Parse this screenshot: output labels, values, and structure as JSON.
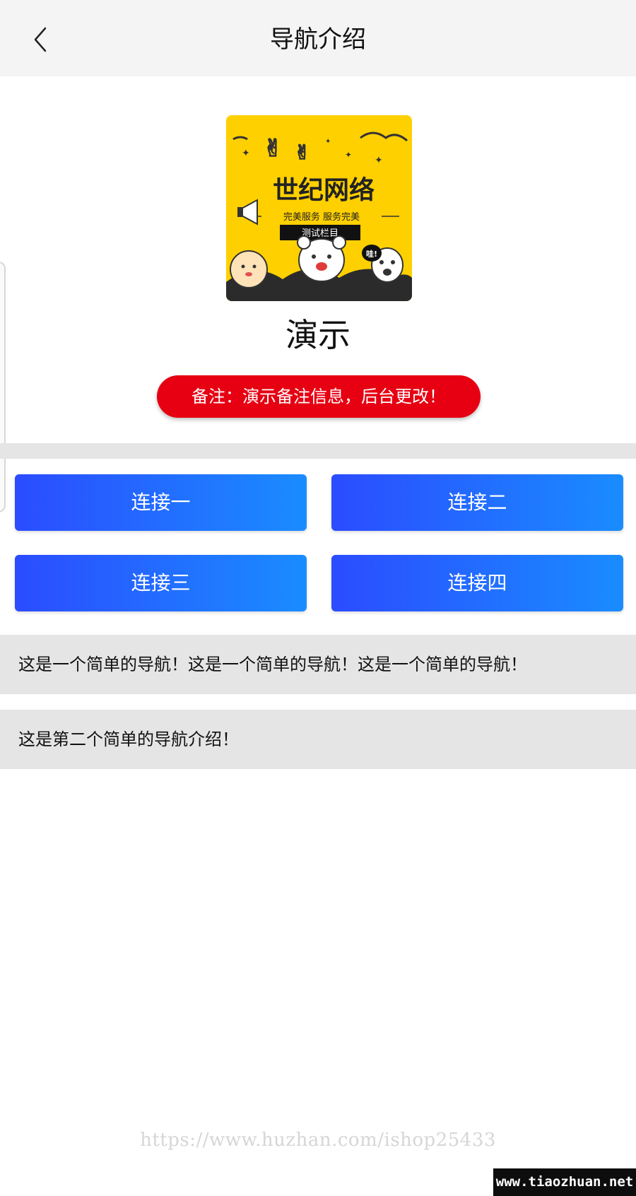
{
  "header": {
    "title": "导航介绍",
    "back_icon": "chevron-left-icon"
  },
  "logo": {
    "title": "世纪网络",
    "subtitle": "完美服务 服务完美",
    "tag": "测试栏目",
    "exclaim": "哇!",
    "background_color": "#ffd000"
  },
  "profile": {
    "name": "演示",
    "note": "备注：演示备注信息，后台更改！",
    "note_color": "#e60012"
  },
  "links": [
    {
      "label": "连接一"
    },
    {
      "label": "连接二"
    },
    {
      "label": "连接三"
    },
    {
      "label": "连接四"
    }
  ],
  "info": [
    {
      "text": "这是一个简单的导航！这是一个简单的导航！这是一个简单的导航！"
    },
    {
      "text": "这是第二个简单的导航介绍！"
    }
  ],
  "watermarks": {
    "url": "https://www.huzhan.com/ishop25433",
    "badge": "www.tiaozhuan.net"
  },
  "colors": {
    "button_gradient_start": "#2b4cff",
    "button_gradient_end": "#1a8cff",
    "section_gray": "#e5e5e5",
    "header_bg": "#f4f4f4"
  }
}
